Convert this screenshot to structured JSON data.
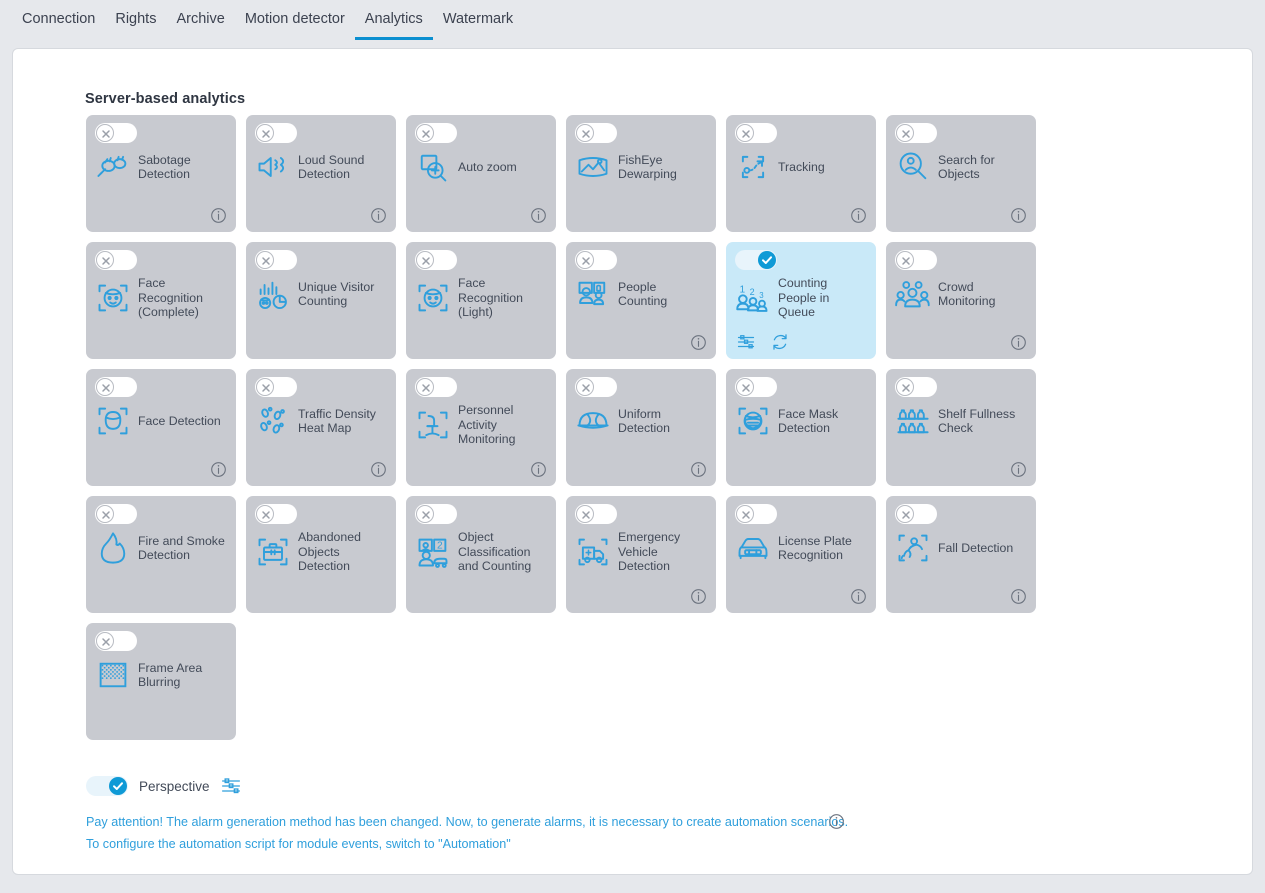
{
  "tabs": [
    {
      "label": "Connection",
      "active": false
    },
    {
      "label": "Rights",
      "active": false
    },
    {
      "label": "Archive",
      "active": false
    },
    {
      "label": "Motion detector",
      "active": false
    },
    {
      "label": "Analytics",
      "active": true
    },
    {
      "label": "Watermark",
      "active": false
    }
  ],
  "section": {
    "title": "Server-based analytics"
  },
  "colors": {
    "accent": "#0b8fd0",
    "icon_blue": "#2f9fdc",
    "card_bg": "#c8cad0",
    "card_bg_active": "#c9e9f8",
    "page_bg": "#e6e8ec",
    "text": "#424a58"
  },
  "cards": [
    {
      "label": "Sabotage Detection",
      "icon": "sabotage-icon",
      "enabled": false,
      "info": true
    },
    {
      "label": "Loud Sound Detection",
      "icon": "loud-sound-icon",
      "enabled": false,
      "info": true
    },
    {
      "label": "Auto zoom",
      "icon": "auto-zoom-icon",
      "enabled": false,
      "info": true
    },
    {
      "label": "FishEye Dewarping",
      "icon": "fisheye-dewarping-icon",
      "enabled": false,
      "info": false
    },
    {
      "label": "Tracking",
      "icon": "tracking-icon",
      "enabled": false,
      "info": true
    },
    {
      "label": "Search for Objects",
      "icon": "search-objects-icon",
      "enabled": false,
      "info": true
    },
    {
      "label": "Face Recognition (Complete)",
      "icon": "face-recognition-icon",
      "enabled": false,
      "info": false
    },
    {
      "label": "Unique Visitor Counting",
      "icon": "unique-visitor-icon",
      "enabled": false,
      "info": false
    },
    {
      "label": "Face Recognition (Light)",
      "icon": "face-recognition-icon",
      "enabled": false,
      "info": false
    },
    {
      "label": "People Counting",
      "icon": "people-counting-icon",
      "enabled": false,
      "info": true
    },
    {
      "label": "Counting People in Queue",
      "icon": "queue-counting-icon",
      "enabled": true,
      "info": false,
      "actions": [
        "settings-icon",
        "refresh-icon"
      ]
    },
    {
      "label": "Crowd Monitoring",
      "icon": "crowd-monitoring-icon",
      "enabled": false,
      "info": true
    },
    {
      "label": "Face Detection",
      "icon": "face-detection-icon",
      "enabled": false,
      "info": true
    },
    {
      "label": "Traffic Density Heat Map",
      "icon": "heat-map-icon",
      "enabled": false,
      "info": true
    },
    {
      "label": "Personnel Activity Monitoring",
      "icon": "personnel-activity-icon",
      "enabled": false,
      "info": true
    },
    {
      "label": "Uniform Detection",
      "icon": "uniform-icon",
      "enabled": false,
      "info": true
    },
    {
      "label": "Face Mask Detection",
      "icon": "face-mask-icon",
      "enabled": false,
      "info": false
    },
    {
      "label": "Shelf Fullness Check",
      "icon": "shelf-fullness-icon",
      "enabled": false,
      "info": true
    },
    {
      "label": "Fire and Smoke Detection",
      "icon": "fire-smoke-icon",
      "enabled": false,
      "info": false
    },
    {
      "label": "Abandoned Objects Detection",
      "icon": "abandoned-object-icon",
      "enabled": false,
      "info": false
    },
    {
      "label": "Object Classification and Counting",
      "icon": "object-classification-icon",
      "enabled": false,
      "info": false
    },
    {
      "label": "Emergency Vehicle Detection",
      "icon": "emergency-vehicle-icon",
      "enabled": false,
      "info": true
    },
    {
      "label": "License Plate Recognition",
      "icon": "license-plate-icon",
      "enabled": false,
      "info": true
    },
    {
      "label": "Fall Detection",
      "icon": "fall-detection-icon",
      "enabled": false,
      "info": true
    },
    {
      "label": "Frame Area Blurring",
      "icon": "frame-blur-icon",
      "enabled": false,
      "info": false
    }
  ],
  "perspective": {
    "label": "Perspective",
    "enabled": true,
    "settings_icon": "settings-icon"
  },
  "notice": {
    "line1": "Pay attention! The alarm generation method has been changed. Now, to generate alarms, it is necessary to create automation scenarios.",
    "line2": "To configure the automation script for module events, switch to \"Automation\"",
    "info_icon": "info-icon"
  }
}
